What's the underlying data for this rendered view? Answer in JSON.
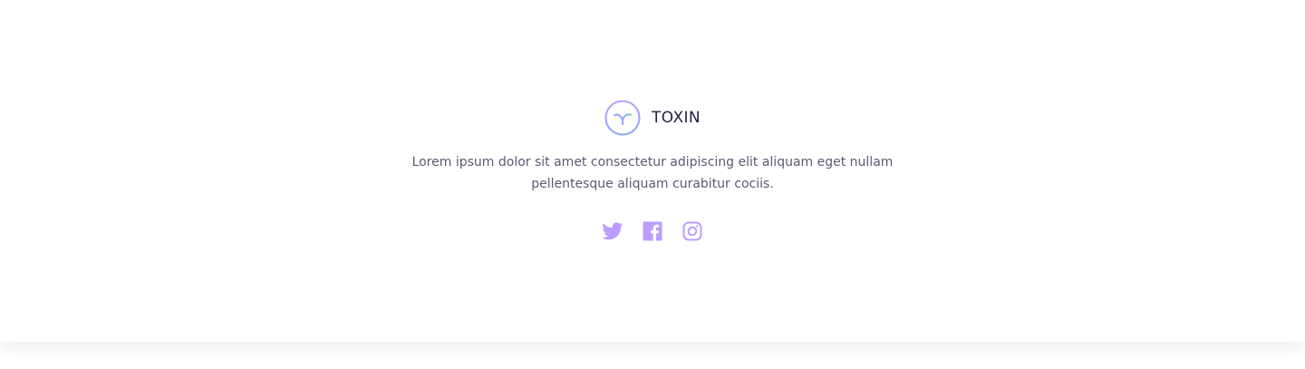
{
  "brand": {
    "name": "TOXIN",
    "logo_icon": "toxin-logo-icon"
  },
  "footer": {
    "description": "Lorem ipsum dolor sit amet consectetur adipiscing elit aliquam eget nullam pellentesque aliquam curabitur cociis."
  },
  "socials": [
    {
      "icon": "twitter-icon"
    },
    {
      "icon": "facebook-icon"
    },
    {
      "icon": "instagram-icon"
    }
  ],
  "colors": {
    "accent_purple": "#bc9cff",
    "accent_green": "#6fcf97",
    "text_dark": "#1f2041"
  }
}
